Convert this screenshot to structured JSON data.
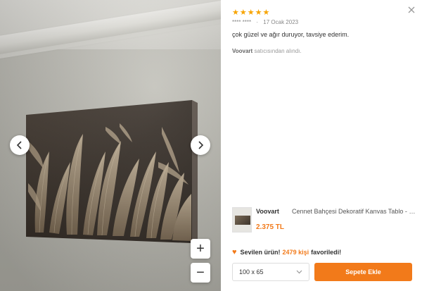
{
  "gallery": {
    "prev_icon": "chevron-left-icon",
    "next_icon": "chevron-right-icon",
    "zoom_in_label": "+",
    "zoom_out_label": "−"
  },
  "review": {
    "stars": "★★★★★",
    "rating": 5,
    "reviewer": "**** ****",
    "date": "17 Ocak 2023",
    "text": "çok güzel ve ağır duruyor, tavsiye ederim.",
    "seller_name": "Voovart",
    "seller_suffix": "satıcısından alındı."
  },
  "product": {
    "brand": "Voovart",
    "name": "Cennet Bahçesi Dekoratif Kanvas Tablo - Voovart",
    "price": "2.375 TL"
  },
  "favorite": {
    "lead": "Sevilen ürün!",
    "count": "2479 kişi",
    "tail": "favoriledi!"
  },
  "size": {
    "selected": "100 x 65"
  },
  "cart": {
    "add_label": "Sepete Ekle"
  },
  "colors": {
    "accent": "#f27a1a",
    "star": "#f7a400"
  }
}
